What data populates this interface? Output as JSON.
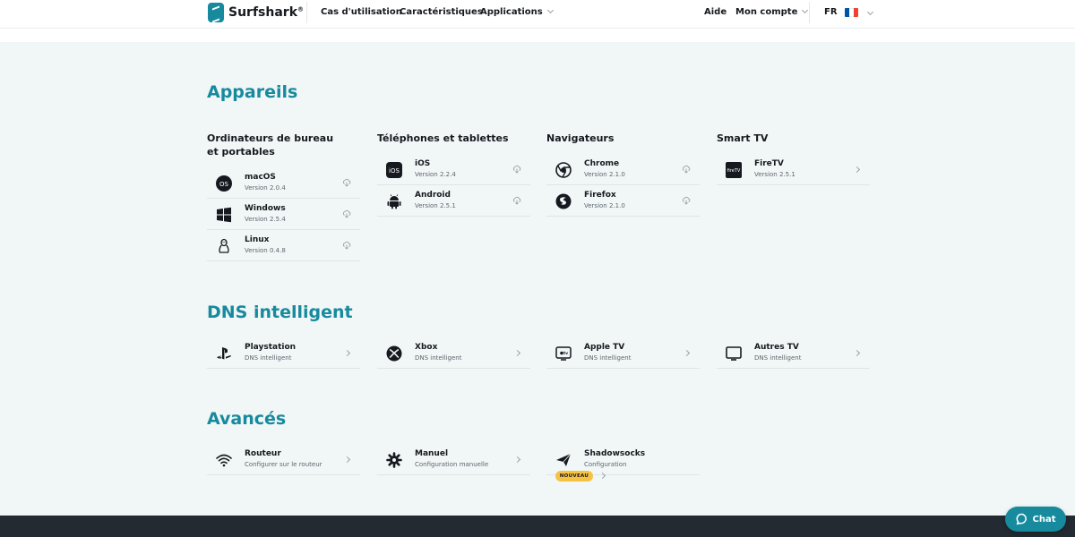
{
  "header": {
    "brand": "Surfshark",
    "brand_mark": "®",
    "nav": [
      "Cas d'utilisation",
      "Caractéristiques",
      "Applications"
    ],
    "help": "Aide",
    "account": "Mon compte",
    "lang": "FR",
    "flag_colors": [
      "#0055a4",
      "#ffffff",
      "#ef4135"
    ]
  },
  "colors": {
    "accent": "#178a9e",
    "badge": "#f6c244",
    "footer": "#232a31",
    "background": "#f1f6f6"
  },
  "devices": {
    "title": "Appareils",
    "columns": [
      {
        "heading": "Ordinateurs de bureau et portables",
        "items": [
          {
            "name": "macOS",
            "sub": "Version 2.0.4",
            "icon": "macos-icon"
          },
          {
            "name": "Windows",
            "sub": "Version 2.5.4",
            "icon": "windows-icon"
          },
          {
            "name": "Linux",
            "sub": "Version 0.4.8",
            "icon": "linux-icon"
          }
        ]
      },
      {
        "heading": "Téléphones et tablettes",
        "items": [
          {
            "name": "iOS",
            "sub": "Version 2.2.4",
            "icon": "ios-icon"
          },
          {
            "name": "Android",
            "sub": "Version 2.5.1",
            "icon": "android-icon"
          }
        ]
      },
      {
        "heading": "Navigateurs",
        "items": [
          {
            "name": "Chrome",
            "sub": "Version 2.1.0",
            "icon": "chrome-icon"
          },
          {
            "name": "Firefox",
            "sub": "Version 2.1.0",
            "icon": "firefox-icon"
          }
        ]
      },
      {
        "heading": "Smart TV",
        "items": [
          {
            "name": "FireTV",
            "sub": "Version 2.5.1",
            "icon": "firetv-icon"
          }
        ]
      }
    ]
  },
  "dns": {
    "title": "DNS intelligent",
    "items": [
      {
        "name": "Playstation",
        "sub": "DNS intelligent",
        "icon": "playstation-icon"
      },
      {
        "name": "Xbox",
        "sub": "DNS intelligent",
        "icon": "xbox-icon"
      },
      {
        "name": "Apple TV",
        "sub": "DNS intelligent",
        "icon": "appletv-icon"
      },
      {
        "name": "Autres TV",
        "sub": "DNS intelligent",
        "icon": "tv-icon"
      }
    ]
  },
  "advanced": {
    "title": "Avancés",
    "items": [
      {
        "name": "Routeur",
        "sub": "Configurer sur le routeur",
        "icon": "wifi-icon"
      },
      {
        "name": "Manuel",
        "sub": "Configuration manuelle",
        "icon": "gear-icon"
      },
      {
        "name": "Shadowsocks",
        "sub": "Configuration",
        "icon": "paper-plane-icon"
      }
    ],
    "badge": "NOUVEAU"
  },
  "chat": {
    "label": "Chat",
    "icon": "chat-bubble-icon"
  },
  "firetv_logo_text": "fireTV",
  "ios_logo_text": "iOS"
}
